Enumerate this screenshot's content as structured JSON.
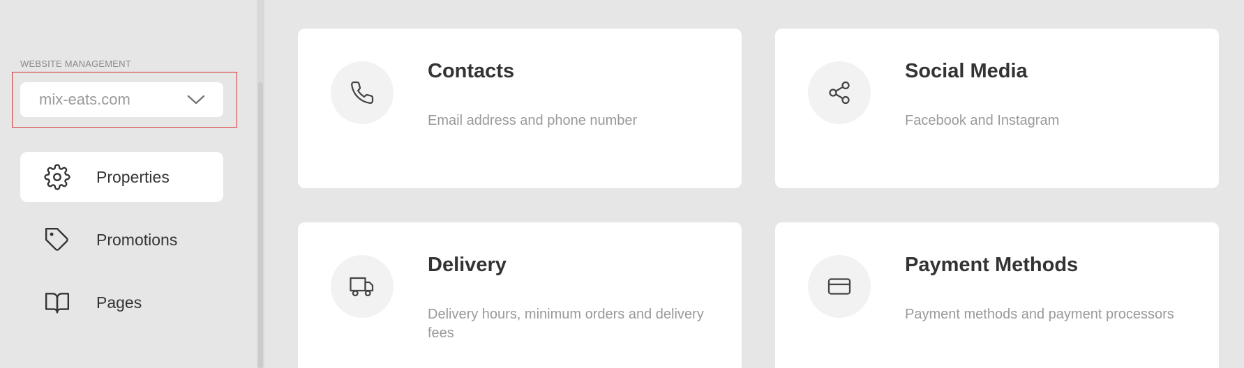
{
  "sidebar": {
    "section_label": "WEBSITE MANAGEMENT",
    "site_select": {
      "value": "mix-eats.com",
      "icon": "chevron-down-icon"
    },
    "items": [
      {
        "label": "Properties",
        "icon": "gear-icon",
        "active": true
      },
      {
        "label": "Promotions",
        "icon": "tag-icon",
        "active": false
      },
      {
        "label": "Pages",
        "icon": "book-icon",
        "active": false
      }
    ]
  },
  "cards": [
    {
      "title": "Contacts",
      "description": "Email address and phone number",
      "icon": "phone-icon"
    },
    {
      "title": "Social Media",
      "description": "Facebook and Instagram",
      "icon": "share-icon"
    },
    {
      "title": "Delivery",
      "description": "Delivery hours, minimum orders and delivery fees",
      "icon": "truck-icon"
    },
    {
      "title": "Payment Methods",
      "description": "Payment methods and payment processors",
      "icon": "credit-card-icon"
    }
  ],
  "colors": {
    "background": "#e6e6e6",
    "card": "#ffffff",
    "icon_circle": "#f2f2f2",
    "text": "#333333",
    "muted_text": "#999999",
    "highlight_border": "#d93030"
  }
}
